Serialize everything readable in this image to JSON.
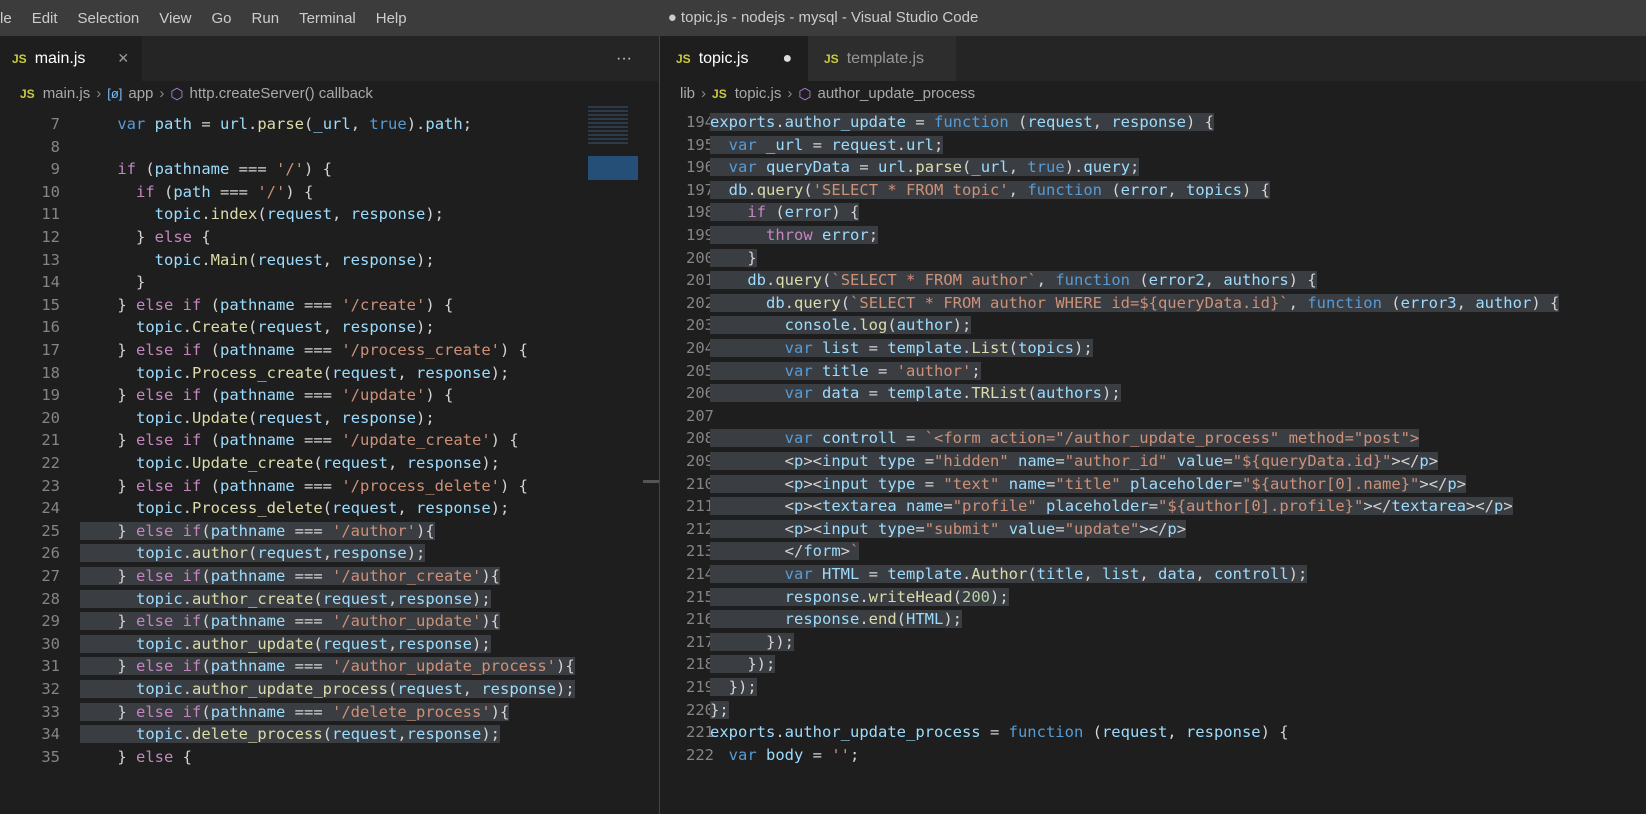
{
  "menu": [
    "le",
    "Edit",
    "Selection",
    "View",
    "Go",
    "Run",
    "Terminal",
    "Help"
  ],
  "window_title": "● topic.js - nodejs - mysql - Visual Studio Code",
  "left": {
    "tabs": [
      {
        "label": "main.js",
        "icon": "JS",
        "close": "✕"
      }
    ],
    "more": "···",
    "breadcrumb": [
      "main.js",
      "app",
      "http.createServer() callback"
    ],
    "first_line": 7,
    "lines": [
      [
        [
          "vr",
          "var path = url.parse(_url, true).path;"
        ]
      ],
      [],
      [
        [
          "ctl",
          "if"
        ],
        [
          "",
          "  (pathname === "
        ],
        [
          "str",
          "'/'"
        ],
        [
          "",
          " ) {"
        ]
      ],
      [
        [
          "",
          ""
        ]
      ],
      [
        [
          "",
          ""
        ]
      ],
      [
        [
          "",
          ""
        ]
      ],
      [
        [
          "",
          ""
        ]
      ],
      [
        [
          "",
          ""
        ]
      ],
      [
        [
          "",
          ""
        ]
      ],
      [
        [
          "",
          ""
        ]
      ],
      [
        [
          "",
          ""
        ]
      ],
      [
        [
          "",
          ""
        ]
      ],
      [
        [
          "",
          ""
        ]
      ],
      [
        [
          "",
          ""
        ]
      ],
      [
        [
          "",
          ""
        ]
      ],
      [
        [
          "",
          ""
        ]
      ],
      [
        [
          "",
          ""
        ]
      ],
      [
        [
          "",
          ""
        ]
      ],
      [
        [
          "",
          ""
        ]
      ],
      [
        [
          "",
          ""
        ]
      ],
      [
        [
          "",
          ""
        ]
      ],
      [
        [
          "",
          ""
        ]
      ],
      [
        [
          "",
          ""
        ]
      ],
      [
        [
          "",
          ""
        ]
      ],
      [
        [
          "",
          ""
        ]
      ],
      [
        [
          "",
          ""
        ]
      ],
      [
        [
          "",
          ""
        ]
      ],
      [
        [
          "",
          ""
        ]
      ],
      [
        [
          "",
          ""
        ]
      ]
    ]
  },
  "left_code": [
    {
      "n": "7",
      "t": "    var path = url.parse(_url, true).path;"
    },
    {
      "n": "8",
      "t": ""
    },
    {
      "n": "9",
      "t": "    if (pathname === '/') {"
    },
    {
      "n": "10",
      "t": "      if (path === '/') {"
    },
    {
      "n": "11",
      "t": "        topic.index(request, response);"
    },
    {
      "n": "12",
      "t": "      } else {"
    },
    {
      "n": "13",
      "t": "        topic.Main(request, response);"
    },
    {
      "n": "14",
      "t": "      }"
    },
    {
      "n": "15",
      "t": "    } else if (pathname === '/create') {"
    },
    {
      "n": "16",
      "t": "      topic.Create(request, response);"
    },
    {
      "n": "17",
      "t": "    } else if (pathname === '/process_create') {"
    },
    {
      "n": "18",
      "t": "      topic.Process_create(request, response);"
    },
    {
      "n": "19",
      "t": "    } else if (pathname === '/update') {"
    },
    {
      "n": "20",
      "t": "      topic.Update(request, response);"
    },
    {
      "n": "21",
      "t": "    } else if (pathname === '/update_create') {"
    },
    {
      "n": "22",
      "t": "      topic.Update_create(request, response);"
    },
    {
      "n": "23",
      "t": "    } else if (pathname === '/process_delete') {"
    },
    {
      "n": "24",
      "t": "      topic.Process_delete(request, response);"
    },
    {
      "n": "25",
      "t": "    } else if(pathname === '/author'){"
    },
    {
      "n": "26",
      "t": "      topic.author(request,response);"
    },
    {
      "n": "27",
      "t": "    } else if(pathname === '/author_create'){"
    },
    {
      "n": "28",
      "t": "      topic.author_create(request,response);"
    },
    {
      "n": "29",
      "t": "    } else if(pathname === '/author_update'){"
    },
    {
      "n": "30",
      "t": "      topic.author_update(request,response);"
    },
    {
      "n": "31",
      "t": "    } else if(pathname === '/author_update_process'){"
    },
    {
      "n": "32",
      "t": "      topic.author_update_process(request, response);"
    },
    {
      "n": "33",
      "t": "    } else if(pathname === '/delete_process'){"
    },
    {
      "n": "34",
      "t": "      topic.delete_process(request,response);"
    },
    {
      "n": "35",
      "t": "    } else {"
    }
  ],
  "right": {
    "tabs": [
      {
        "label": "topic.js",
        "icon": "JS",
        "dirty": "●"
      },
      {
        "label": "template.js",
        "icon": "JS"
      }
    ],
    "breadcrumb": [
      "lib",
      "topic.js",
      "author_update_process"
    ]
  },
  "right_code": [
    {
      "n": "194",
      "t": "exports.author_update = function (request, response) {"
    },
    {
      "n": "195",
      "t": "  var _url = request.url;"
    },
    {
      "n": "196",
      "t": "  var queryData = url.parse(_url, true).query;"
    },
    {
      "n": "197",
      "t": "  db.query('SELECT * FROM topic', function (error, topics) {"
    },
    {
      "n": "198",
      "t": "    if (error) {"
    },
    {
      "n": "199",
      "t": "      throw error;"
    },
    {
      "n": "200",
      "t": "    }"
    },
    {
      "n": "201",
      "t": "    db.query(`SELECT * FROM author`, function (error2, authors) {"
    },
    {
      "n": "202",
      "t": "      db.query(`SELECT * FROM author WHERE id=${queryData.id}`, function (error3, author) {"
    },
    {
      "n": "203",
      "t": "        console.log(author);"
    },
    {
      "n": "204",
      "t": "        var list = template.List(topics);"
    },
    {
      "n": "205",
      "t": "        var title = 'author';"
    },
    {
      "n": "206",
      "t": "        var data = template.TRList(authors);"
    },
    {
      "n": "207",
      "t": ""
    },
    {
      "n": "208",
      "t": "        var controll = `<form action=\"/author_update_process\" method=\"post\">"
    },
    {
      "n": "209",
      "t": "        <p><input type =\"hidden\" name=\"author_id\" value=\"${queryData.id}\"></p>"
    },
    {
      "n": "210",
      "t": "        <p><input type = \"text\" name=\"title\" placeholder=\"${author[0].name}\"></p>"
    },
    {
      "n": "211",
      "t": "        <p><textarea name=\"profile\" placeholder=\"${author[0].profile}\"></textarea></p>"
    },
    {
      "n": "212",
      "t": "        <p><input type=\"submit\" value=\"update\"></p>"
    },
    {
      "n": "213",
      "t": "        </form>`"
    },
    {
      "n": "214",
      "t": "        var HTML = template.Author(title, list, data, controll);"
    },
    {
      "n": "215",
      "t": "        response.writeHead(200);"
    },
    {
      "n": "216",
      "t": "        response.end(HTML);"
    },
    {
      "n": "217",
      "t": "      });"
    },
    {
      "n": "218",
      "t": "    });"
    },
    {
      "n": "219",
      "t": "  });"
    },
    {
      "n": "220",
      "t": "};"
    },
    {
      "n": "221",
      "t": "exports.author_update_process = function (request, response) {"
    },
    {
      "n": "222",
      "t": "  var body = '';"
    }
  ],
  "colors": {
    "titlebar": "#3c3c3c",
    "editor": "#1e1e1e",
    "selection": "#3a3d41",
    "keyword": "#569cd6",
    "string": "#ce9178",
    "function": "#dcdcaa",
    "variable": "#9cdcfe"
  }
}
